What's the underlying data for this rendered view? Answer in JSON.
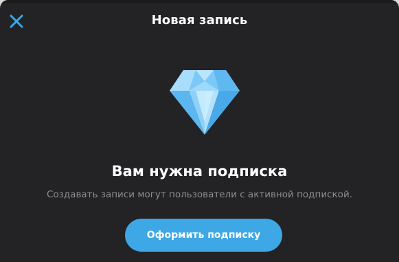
{
  "header": {
    "title": "Новая запись",
    "close_icon": "close-icon"
  },
  "paywall": {
    "icon": "diamond-icon",
    "headline": "Вам нужна подписка",
    "description": "Создавать записи могут пользователи с активной подпиской.",
    "cta_label": "Оформить подписку"
  },
  "colors": {
    "background": "#232325",
    "accent": "#3ea7e6",
    "text_primary": "#ffffff",
    "text_secondary": "#8b8e93"
  }
}
